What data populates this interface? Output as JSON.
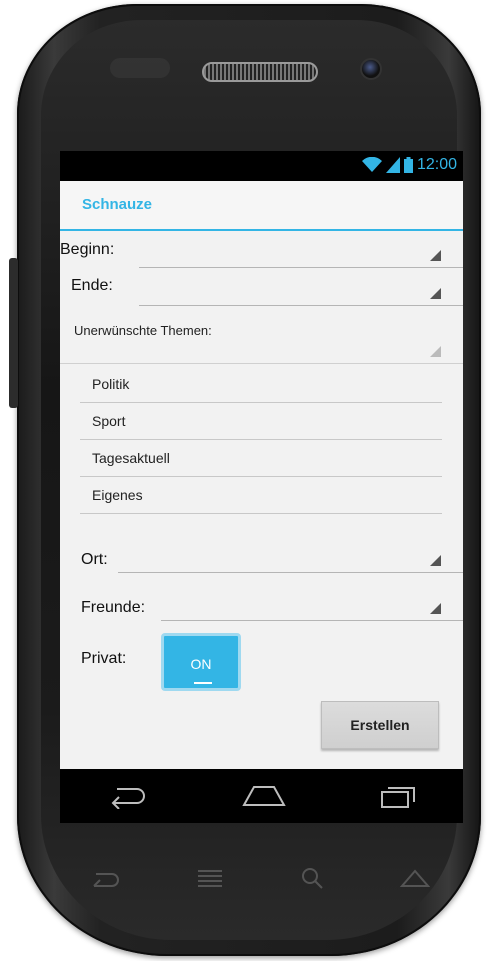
{
  "status_bar": {
    "time": "12:00"
  },
  "action_bar": {
    "title": "Schnauze"
  },
  "form": {
    "beginn_label": "Beginn:",
    "ende_label": "Ende:",
    "themes_label": "Unerwünschte Themen:",
    "themes": [
      "Politik",
      "Sport",
      "Tagesaktuell",
      "Eigenes"
    ],
    "ort_label": "Ort:",
    "freunde_label": "Freunde:",
    "privat_label": "Privat:",
    "privat_toggle": "ON",
    "submit_label": "Erstellen"
  },
  "colors": {
    "accent": "#33b5e5",
    "background": "#f2f2f2",
    "bars": "#000000"
  },
  "icons": [
    "wifi-icon",
    "signal-icon",
    "battery-icon",
    "back-icon",
    "home-icon",
    "recent-apps-icon"
  ]
}
